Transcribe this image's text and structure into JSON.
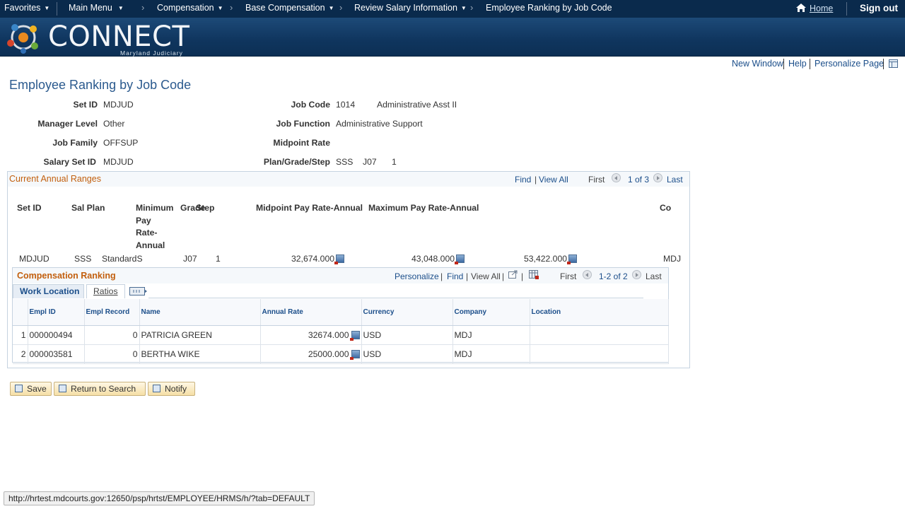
{
  "topnav": {
    "items": [
      "Favorites",
      "Main Menu",
      "Compensation",
      "Base Compensation",
      "Review Salary Information",
      "Employee Ranking by Job Code"
    ],
    "home": "Home",
    "signout": "Sign out",
    "bg_color": "#0a2a4c"
  },
  "banner": {
    "logo_text": "CONNECT",
    "logo_subtext": "Maryland Judiciary"
  },
  "util": {
    "new_window": "New Window",
    "help": "Help",
    "personalize_page": "Personalize Page"
  },
  "page": {
    "title": "Employee Ranking by Job Code"
  },
  "fields": {
    "setid_label": "Set ID",
    "setid_value": "MDJUD",
    "manager_level_label": "Manager Level",
    "manager_level_value": "Other",
    "job_family_label": "Job Family",
    "job_family_value": "OFFSUP",
    "salary_setid_label": "Salary Set ID",
    "salary_setid_value": "MDJUD",
    "job_code_label": "Job Code",
    "job_code_value": "1014",
    "job_code_descr": "Administrative Asst II",
    "job_function_label": "Job Function",
    "job_function_value": "Administrative Support",
    "midpoint_rate_label": "Midpoint Rate",
    "plan_grade_step_label": "Plan/Grade/Step",
    "plan_value": "SSS",
    "grade_value": "J07",
    "step_value": "1"
  },
  "ranges": {
    "title": "Current Annual Ranges",
    "find": "Find",
    "view_all": "View All",
    "first": "First",
    "count": "1 of 3",
    "last": "Last",
    "headers": {
      "setid": "Set ID",
      "sal_plan": "Sal Plan",
      "min_line1": "Minimum",
      "min_line2": "Pay",
      "min_line3": "Rate-",
      "min_line4": "Annual",
      "grade": "Grade",
      "step": "Step",
      "mid": "Midpoint Pay Rate-Annual",
      "max": "Maximum Pay Rate-Annual",
      "co": "Co"
    },
    "row": {
      "setid": "MDJUD",
      "sal_plan": "SSS",
      "sal_plan_descr": "StandardS",
      "grade": "J07",
      "step": "1",
      "min": "32,674.000",
      "mid": "43,048.000",
      "max": "53,422.000",
      "co": "MDJ"
    }
  },
  "ranking": {
    "title": "Compensation Ranking",
    "personalize": "Personalize",
    "find": "Find",
    "view_all": "View All",
    "first": "First",
    "count": "1-2 of 2",
    "last": "Last",
    "tabs": [
      "Work Location",
      "Ratios"
    ],
    "columns": [
      "Empl ID",
      "Empl Record",
      "Name",
      "Annual Rate",
      "Currency",
      "Company",
      "Location"
    ],
    "rows": [
      {
        "num": "1",
        "emplid": "000000494",
        "rcd": "0",
        "name": "PATRICIA GREEN",
        "rate": "32674.000",
        "currency": "USD",
        "company": "MDJ",
        "location": ""
      },
      {
        "num": "2",
        "emplid": "000003581",
        "rcd": "0",
        "name": "BERTHA WIKE",
        "rate": "25000.000",
        "currency": "USD",
        "company": "MDJ",
        "location": ""
      }
    ]
  },
  "buttons": {
    "save": "Save",
    "return_to_search": "Return to Search",
    "notify": "Notify"
  },
  "status": {
    "url": "http://hrtest.mdcourts.gov:12650/psp/hrtst/EMPLOYEE/HRMS/h/?tab=DEFAULT"
  }
}
